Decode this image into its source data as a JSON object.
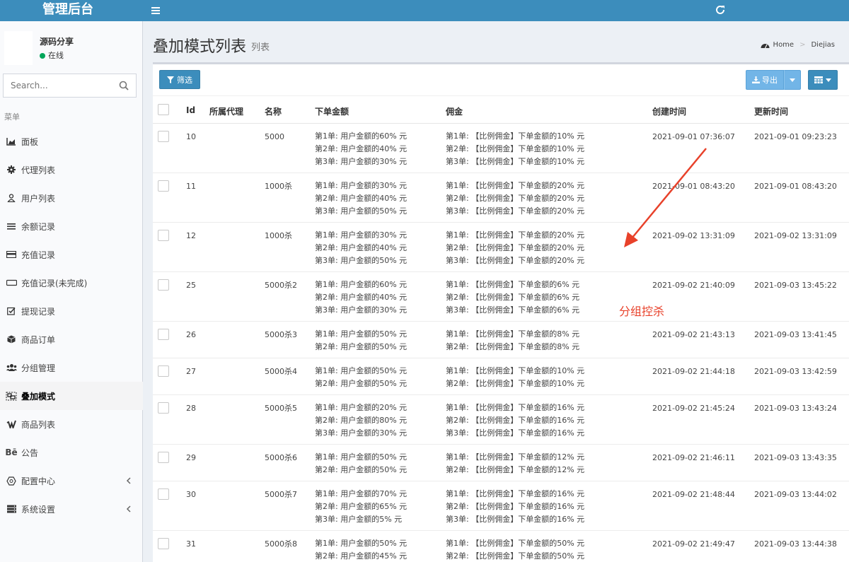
{
  "header": {
    "logo": "管理后台"
  },
  "sidebar": {
    "user": {
      "name": "源码分享",
      "status": "在线"
    },
    "search": {
      "placeholder": "Search..."
    },
    "menu_header": "菜单",
    "items": [
      {
        "label": "面板",
        "icon": "area-chart-icon"
      },
      {
        "label": "代理列表",
        "icon": "cog-icon"
      },
      {
        "label": "用户列表",
        "icon": "user-icon"
      },
      {
        "label": "余额记录",
        "icon": "list-icon"
      },
      {
        "label": "充值记录",
        "icon": "card-icon"
      },
      {
        "label": "充值记录(未完成)",
        "icon": "rectangle-icon"
      },
      {
        "label": "提现记录",
        "icon": "check-square-icon"
      },
      {
        "label": "商品订单",
        "icon": "cube-icon"
      },
      {
        "label": "分组管理",
        "icon": "users-icon"
      },
      {
        "label": "叠加模式",
        "icon": "object-group-icon",
        "active": true
      },
      {
        "label": "商品列表",
        "icon": "vimeo-icon"
      },
      {
        "label": "公告",
        "icon": "behance-icon"
      },
      {
        "label": "配置中心",
        "icon": "hexagon-icon",
        "chevron": true
      },
      {
        "label": "系统设置",
        "icon": "server-icon",
        "chevron": true
      }
    ]
  },
  "page": {
    "title": "叠加模式列表",
    "subtitle": "列表",
    "breadcrumb": {
      "home": "Home",
      "current": "Diejias"
    }
  },
  "toolbar": {
    "filter_label": "筛选",
    "export_label": "导出"
  },
  "table": {
    "columns": [
      "Id",
      "所属代理",
      "名称",
      "下单金额",
      "佣金",
      "创建时间",
      "更新时间"
    ],
    "rows": [
      {
        "id": "10",
        "agent": "",
        "name": "5000",
        "amounts": [
          "第1单: 用户金额的60% 元",
          "第2单: 用户金额的40% 元",
          "第3单: 用户金额的30% 元"
        ],
        "commissions": [
          "第1单: 【比例佣金】下单金额的10% 元",
          "第2单: 【比例佣金】下单金额的10% 元",
          "第3单: 【比例佣金】下单金额的10% 元"
        ],
        "created": "2021-09-01 07:36:07",
        "updated": "2021-09-01 09:23:23"
      },
      {
        "id": "11",
        "agent": "",
        "name": "1000杀",
        "amounts": [
          "第1单: 用户金额的30% 元",
          "第2单: 用户金额的40% 元",
          "第3单: 用户金额的50% 元"
        ],
        "commissions": [
          "第1单: 【比例佣金】下单金额的20% 元",
          "第2单: 【比例佣金】下单金额的20% 元",
          "第3单: 【比例佣金】下单金额的20% 元"
        ],
        "created": "2021-09-01 08:43:20",
        "updated": "2021-09-01 08:43:20"
      },
      {
        "id": "12",
        "agent": "",
        "name": "1000杀",
        "amounts": [
          "第1单: 用户金额的30% 元",
          "第2单: 用户金额的40% 元",
          "第3单: 用户金额的50% 元"
        ],
        "commissions": [
          "第1单: 【比例佣金】下单金额的20% 元",
          "第2单: 【比例佣金】下单金额的20% 元",
          "第3单: 【比例佣金】下单金额的20% 元"
        ],
        "created": "2021-09-02 13:31:09",
        "updated": "2021-09-02 13:31:09"
      },
      {
        "id": "25",
        "agent": "",
        "name": "5000杀2",
        "amounts": [
          "第1单: 用户金额的60% 元",
          "第2单: 用户金额的40% 元",
          "第3单: 用户金额的30% 元"
        ],
        "commissions": [
          "第1单: 【比例佣金】下单金额的6% 元",
          "第2单: 【比例佣金】下单金额的6% 元",
          "第3单: 【比例佣金】下单金额的6% 元"
        ],
        "created": "2021-09-02 21:40:09",
        "updated": "2021-09-03 13:45:22"
      },
      {
        "id": "26",
        "agent": "",
        "name": "5000杀3",
        "amounts": [
          "第1单: 用户金额的50% 元",
          "第2单: 用户金额的50% 元"
        ],
        "commissions": [
          "第1单: 【比例佣金】下单金额的8% 元",
          "第2单: 【比例佣金】下单金额的8% 元"
        ],
        "created": "2021-09-02 21:43:13",
        "updated": "2021-09-03 13:41:45"
      },
      {
        "id": "27",
        "agent": "",
        "name": "5000杀4",
        "amounts": [
          "第1单: 用户金额的50% 元",
          "第2单: 用户金额的50% 元"
        ],
        "commissions": [
          "第1单: 【比例佣金】下单金额的10% 元",
          "第2单: 【比例佣金】下单金额的10% 元"
        ],
        "created": "2021-09-02 21:44:18",
        "updated": "2021-09-03 13:42:59"
      },
      {
        "id": "28",
        "agent": "",
        "name": "5000杀5",
        "amounts": [
          "第1单: 用户金额的20% 元",
          "第2单: 用户金额的80% 元",
          "第3单: 用户金额的30% 元"
        ],
        "commissions": [
          "第1单: 【比例佣金】下单金额的16% 元",
          "第2单: 【比例佣金】下单金额的16% 元",
          "第3单: 【比例佣金】下单金额的16% 元"
        ],
        "created": "2021-09-02 21:45:24",
        "updated": "2021-09-03 13:43:24"
      },
      {
        "id": "29",
        "agent": "",
        "name": "5000杀6",
        "amounts": [
          "第1单: 用户金额的50% 元",
          "第2单: 用户金额的50% 元"
        ],
        "commissions": [
          "第1单: 【比例佣金】下单金额的12% 元",
          "第2单: 【比例佣金】下单金额的12% 元"
        ],
        "created": "2021-09-02 21:46:11",
        "updated": "2021-09-03 13:43:35"
      },
      {
        "id": "30",
        "agent": "",
        "name": "5000杀7",
        "amounts": [
          "第1单: 用户金额的70% 元",
          "第2单: 用户金额的65% 元",
          "第3单: 用户金额的5% 元"
        ],
        "commissions": [
          "第1单: 【比例佣金】下单金额的16% 元",
          "第2单: 【比例佣金】下单金额的16% 元",
          "第3单: 【比例佣金】下单金额的16% 元"
        ],
        "created": "2021-09-02 21:48:44",
        "updated": "2021-09-03 13:44:02"
      },
      {
        "id": "31",
        "agent": "",
        "name": "5000杀8",
        "amounts": [
          "第1单: 用户金额的50% 元",
          "第2单: 用户金额的45% 元"
        ],
        "commissions": [
          "第1单: 【比例佣金】下单金额的50% 元",
          "第2单: 【比例佣金】下单金额的50% 元"
        ],
        "created": "2021-09-02 21:49:47",
        "updated": "2021-09-03 13:44:38"
      }
    ]
  },
  "annotation": {
    "text": "分组控杀",
    "color": "#e8412a"
  },
  "colors": {
    "header": "#3c8dbc",
    "primary_button": "#3c8dbc",
    "export_button": "#72b5e7",
    "online": "#00a65a"
  }
}
